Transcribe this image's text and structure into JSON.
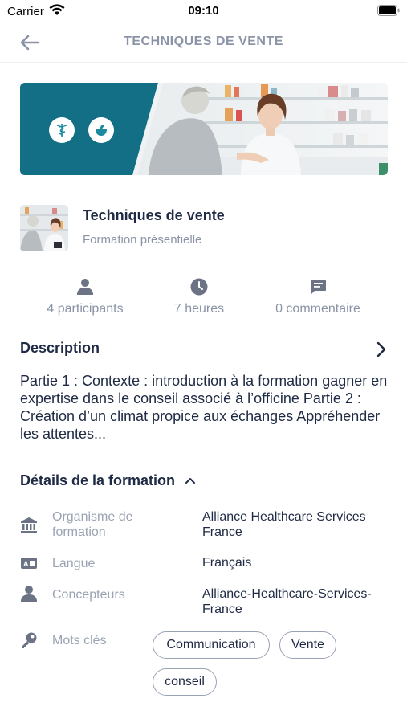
{
  "status_bar": {
    "carrier": "Carrier",
    "time": "09:10",
    "wifi_icon": "wifi-icon",
    "battery_icon": "battery-icon"
  },
  "nav": {
    "title": "TECHNIQUES DE VENTE",
    "back_icon": "arrow-left-icon"
  },
  "banner": {
    "icons": [
      "caduceus-icon",
      "pill-mortar-icon"
    ],
    "image": "pharmacist-serving-customer"
  },
  "course": {
    "title": "Techniques de vente",
    "type": "Formation présentielle"
  },
  "stats": [
    {
      "icon": "person-icon",
      "label": "4 participants"
    },
    {
      "icon": "clock-icon",
      "label": "7 heures"
    },
    {
      "icon": "comment-icon",
      "label": "0 commentaire"
    }
  ],
  "description": {
    "title": "Description",
    "text": "Partie 1 : Contexte : introduction à la formation gagner en expertise dans le conseil associé à l’officine   Partie 2 : Création d’un climat propice aux échanges Appréhender les attentes..."
  },
  "details": {
    "title": "Détails de la formation",
    "rows": [
      {
        "icon": "bank-icon",
        "label": "Organisme de formation",
        "value": "Alliance Healthcare Services France"
      },
      {
        "icon": "language-icon",
        "label": "Langue",
        "value": "Français"
      },
      {
        "icon": "person-icon",
        "label": "Concepteurs",
        "value": "Alliance-Healthcare-Services-France"
      },
      {
        "icon": "key-icon",
        "label": "Mots clés"
      }
    ],
    "tags": [
      "Communication",
      "Vente",
      "conseil"
    ]
  },
  "colors": {
    "primary_text": "#1f2a44",
    "secondary_text": "#8a94a6",
    "banner_teal": "#126f86",
    "icon_gray": "#6b7385"
  }
}
